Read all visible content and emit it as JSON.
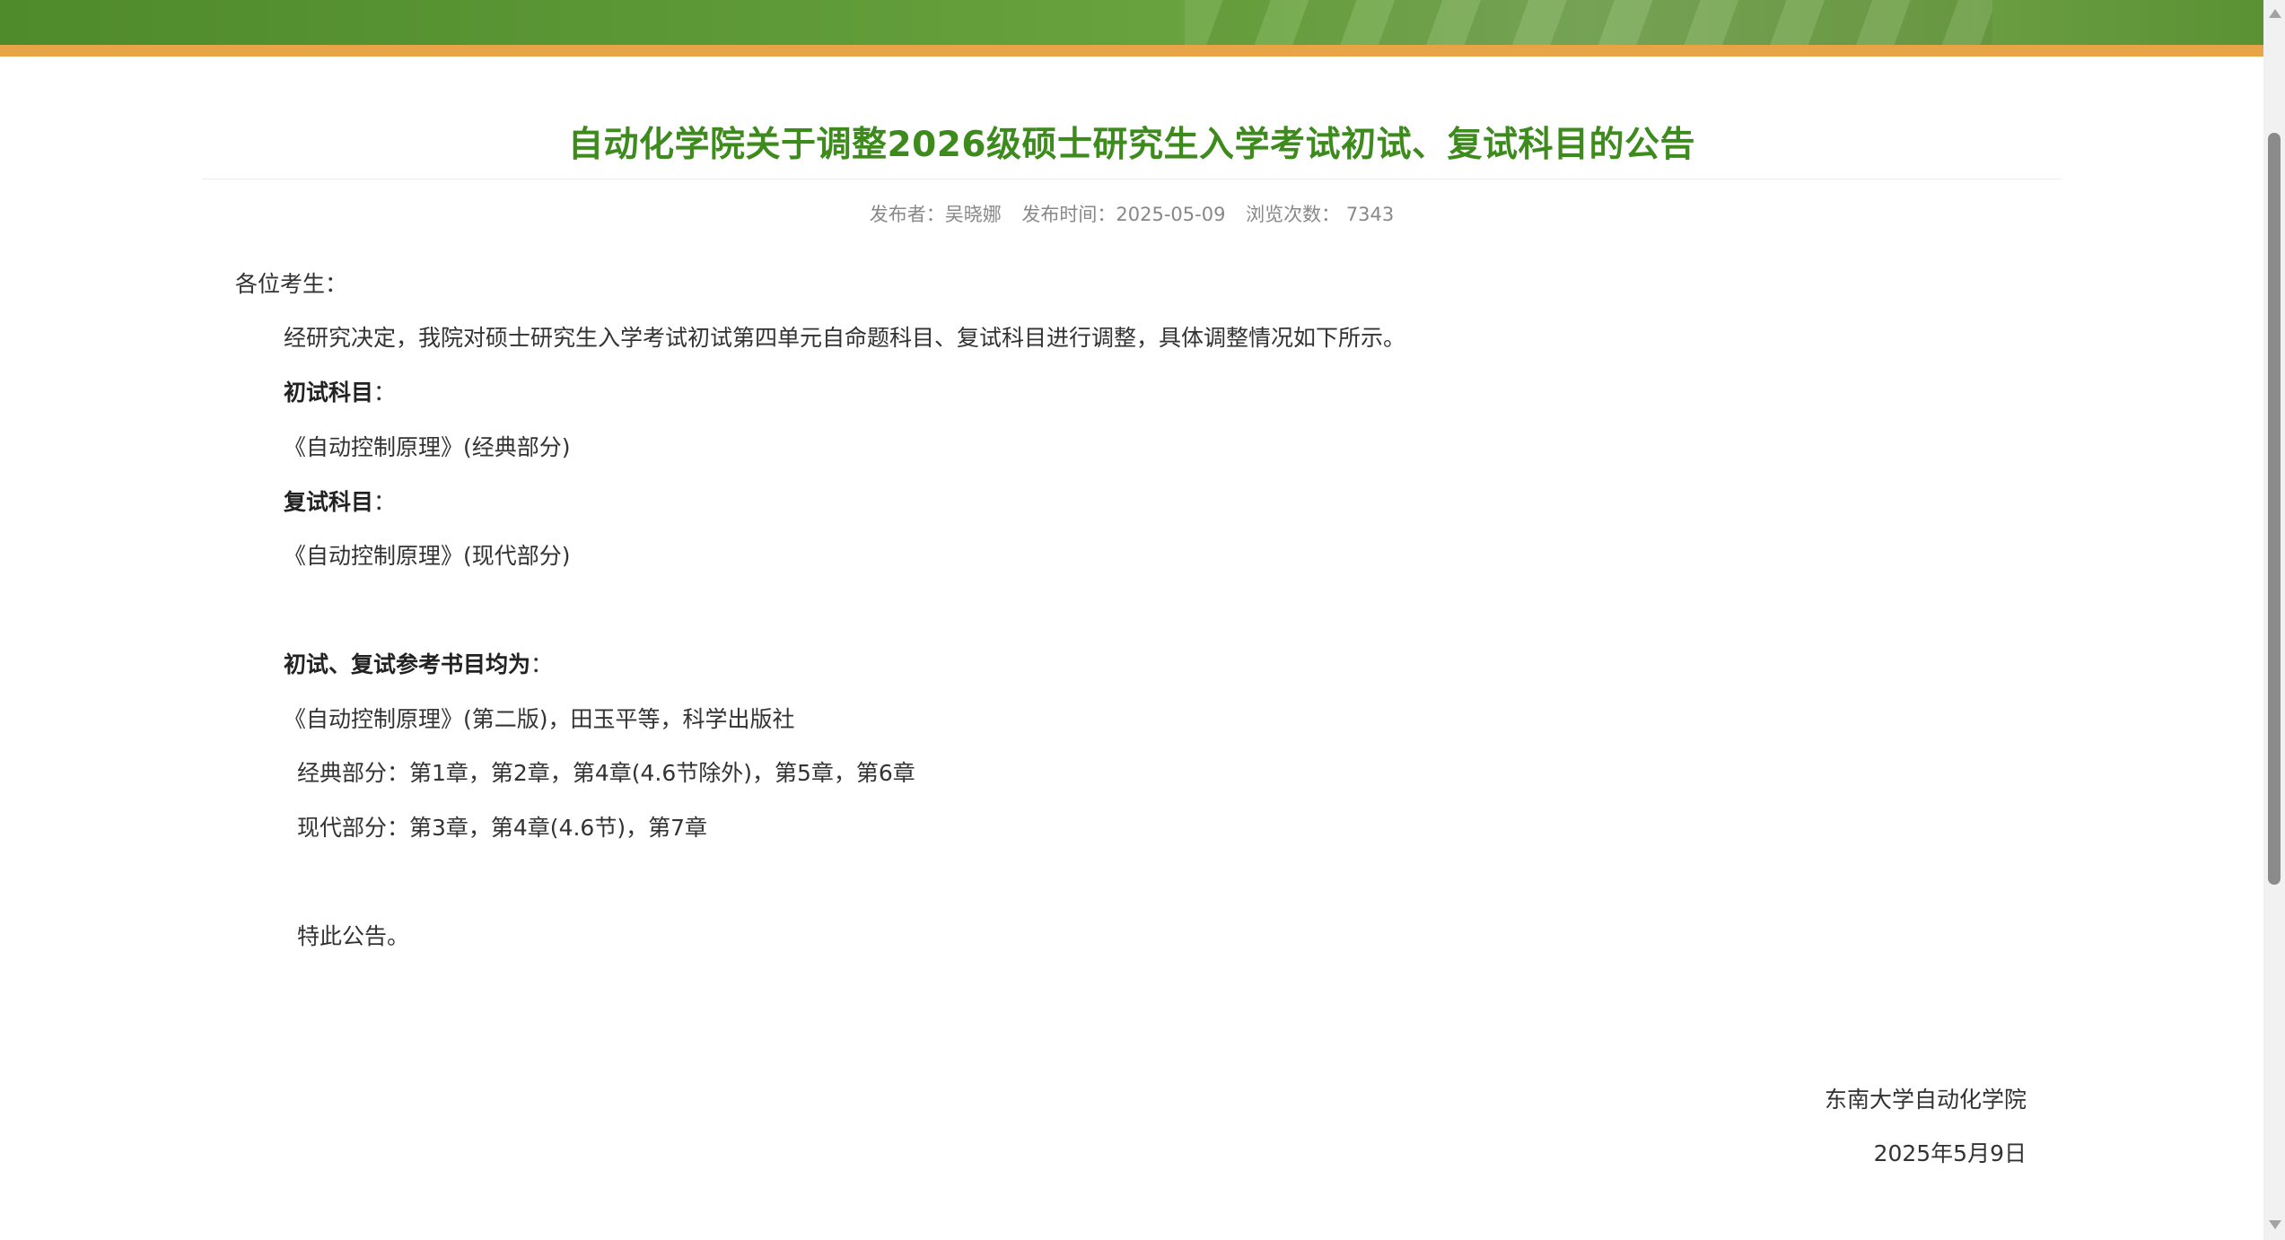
{
  "article": {
    "title": "自动化学院关于调整2026级硕士研究生入学考试初试、复试科目的公告",
    "meta": {
      "publisher": "发布者：吴晓娜",
      "publish_time": "发布时间：2025-05-09",
      "views": "浏览次数： 7343"
    },
    "salutation": "各位考生：",
    "intro": "经研究决定，我院对硕士研究生入学考试初试第四单元自命题科目、复试科目进行调整，具体调整情况如下所示。",
    "initial_exam_heading": "初试科目",
    "initial_exam_colon": "：",
    "initial_exam_subject": "《自动控制原理》(经典部分)",
    "retest_heading": "复试科目",
    "retest_colon": "：",
    "retest_subject": "《自动控制原理》(现代部分)",
    "reference_heading": "初试、复试参考书目均为",
    "reference_colon": "：",
    "reference_book": "《自动控制原理》(第二版)，田玉平等，科学出版社",
    "classic_part": "经典部分：第1章，第2章，第4章(4.6节除外)，第5章，第6章",
    "modern_part": "现代部分：第3章，第4章(4.6节)，第7章",
    "closing": "特此公告。",
    "signature_org": "东南大学自动化学院",
    "signature_date": "2025年5月9日"
  },
  "colors": {
    "title_green": "#3d8a1d",
    "banner_green": "#5f9a38",
    "banner_orange": "#e8a547"
  }
}
